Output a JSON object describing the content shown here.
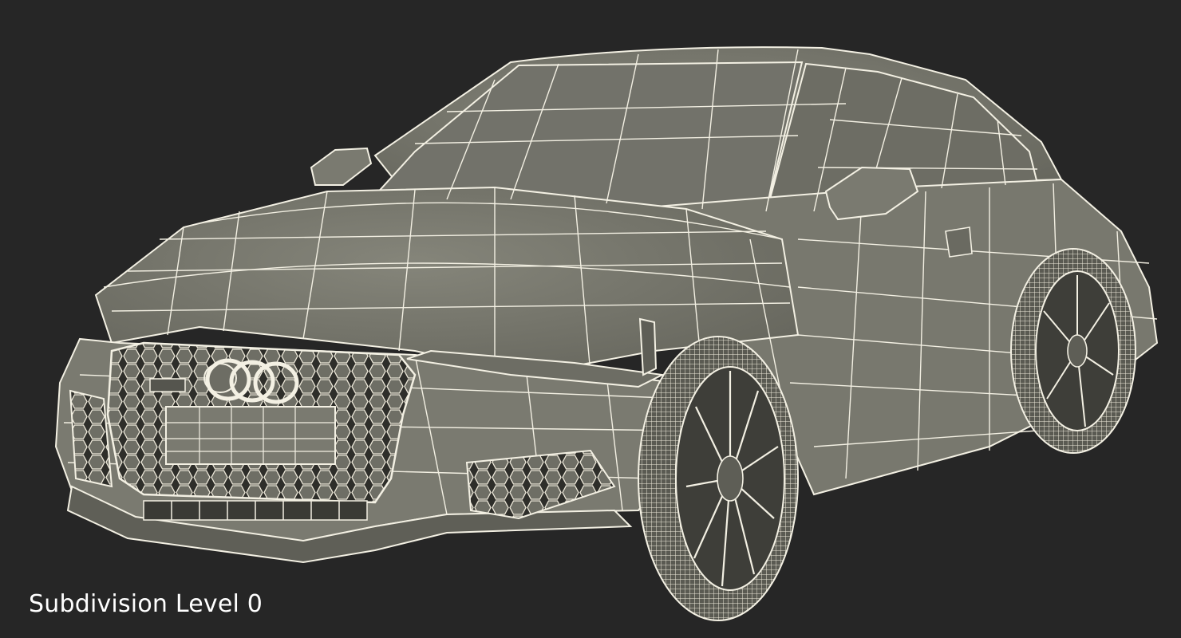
{
  "viewport": {
    "caption": "Subdivision Level 0",
    "background_color": "#262626"
  },
  "model": {
    "surface_color": "#76766c",
    "wire_color": "#f3f0e3",
    "dark_color": "#3a3a35"
  }
}
